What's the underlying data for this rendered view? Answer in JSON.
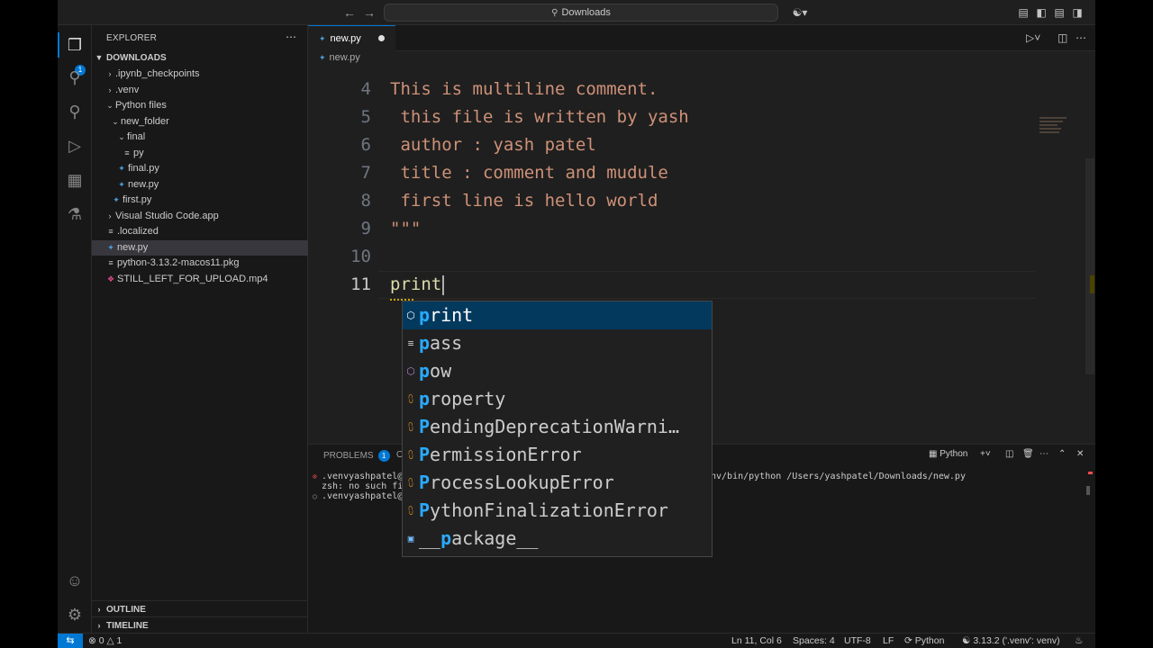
{
  "titlebar": {
    "search_label": "Downloads"
  },
  "sidebar": {
    "title": "EXPLORER",
    "folder": "DOWNLOADS",
    "outline": "OUTLINE",
    "timeline": "TIMELINE",
    "tree": [
      {
        "label": ".ipynb_checkpoints",
        "type": "folder",
        "expanded": false
      },
      {
        "label": ".venv",
        "type": "folder",
        "expanded": false
      },
      {
        "label": "Python files",
        "type": "folder",
        "expanded": true
      },
      {
        "label": "new_folder",
        "type": "folder",
        "expanded": true
      },
      {
        "label": "final",
        "type": "folder",
        "expanded": true
      },
      {
        "label": "py",
        "type": "file"
      },
      {
        "label": "final.py",
        "type": "python"
      },
      {
        "label": "new.py",
        "type": "python"
      },
      {
        "label": "first.py",
        "type": "python"
      },
      {
        "label": "Visual Studio Code.app",
        "type": "folder",
        "expanded": false
      },
      {
        "label": ".localized",
        "type": "file"
      },
      {
        "label": "new.py",
        "type": "python",
        "selected": true
      },
      {
        "label": "python-3.13.2-macos11.pkg",
        "type": "file"
      },
      {
        "label": "STILL_LEFT_FOR_UPLOAD.mp4",
        "type": "video"
      }
    ]
  },
  "activity": {
    "explorer_badge": "1"
  },
  "editor": {
    "tab_label": "new.py",
    "breadcrumb": "new.py",
    "lines": [
      {
        "n": "4",
        "text": "This is multiline comment."
      },
      {
        "n": "5",
        "text": " this file is written by yash"
      },
      {
        "n": "6",
        "text": " author : yash patel"
      },
      {
        "n": "7",
        "text": " title : comment and mudule"
      },
      {
        "n": "8",
        "text": " first line is hello world"
      },
      {
        "n": "9",
        "text": "\"\"\""
      },
      {
        "n": "10",
        "text": ""
      },
      {
        "n": "11",
        "text": "print"
      }
    ]
  },
  "suggest": {
    "items": [
      {
        "match": "p",
        "rest": "rint",
        "icon": "method",
        "selected": true
      },
      {
        "match": "p",
        "rest": "ass",
        "icon": "keyword"
      },
      {
        "match": "p",
        "rest": "ow",
        "icon": "method"
      },
      {
        "match": "p",
        "rest": "roperty",
        "icon": "class"
      },
      {
        "match": "P",
        "rest": "endingDeprecationWarni…",
        "icon": "class"
      },
      {
        "match": "P",
        "rest": "ermissionError",
        "icon": "class"
      },
      {
        "match": "P",
        "rest": "rocessLookupError",
        "icon": "class"
      },
      {
        "match": "P",
        "rest": "ythonFinalizationError",
        "icon": "class"
      },
      {
        "pre": "__",
        "match": "p",
        "rest": "ackage__",
        "icon": "variable"
      }
    ]
  },
  "panel": {
    "problems_label": "PROBLEMS",
    "problems_count": "1",
    "output_label_fragment": "O",
    "terminal_label": "Python",
    "terminal_lines": [
      {
        "mark": "error",
        "left": ".venvyashpatel@\\",
        "right": "nv/bin/python /Users/yashpatel/Downloads/new.py"
      },
      {
        "mark": "none",
        "left": "zsh: no such fil",
        "right": ""
      },
      {
        "mark": "circle",
        "left": ".venvyashpatel@\\",
        "right": ""
      }
    ]
  },
  "statusbar": {
    "errors": "0",
    "warnings": "1",
    "position": "Ln 11, Col 6",
    "spaces": "Spaces: 4",
    "encoding": "UTF-8",
    "eol": "LF",
    "language": "Python",
    "interpreter": "3.13.2 ('.venv': venv)"
  }
}
